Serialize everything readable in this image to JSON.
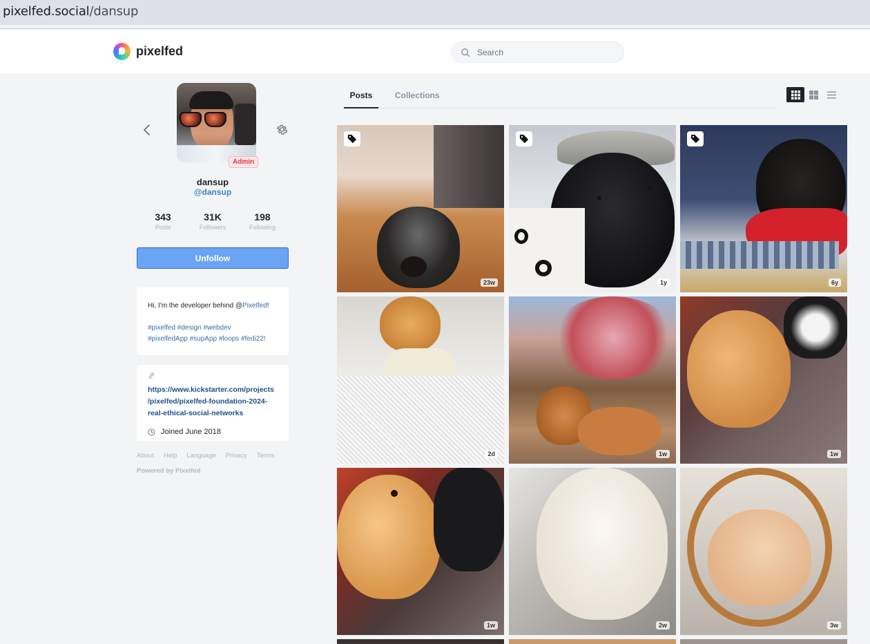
{
  "browser": {
    "domain": "pixelfed.social",
    "path": "/dansup"
  },
  "nav": {
    "brand": "pixelfed",
    "search_placeholder": "Search"
  },
  "profile": {
    "display_name": "dansup",
    "username": "@dansup",
    "badge": "Admin",
    "stats": [
      {
        "value": "343",
        "label": "Posts"
      },
      {
        "value": "31K",
        "label": "Followers"
      },
      {
        "value": "198",
        "label": "Following"
      }
    ],
    "follow_label": "Unfollow",
    "bio": {
      "intro": "Hi, I'm the developer behind @",
      "mention": "Pixelfed",
      "intro_end": "!",
      "tags_line1": "#pixelfed #design #webdev",
      "tags_line2": "#pixelfedApp #supApp #loops #fedi22!"
    },
    "website": "https://www.kickstarter.com/projects/pixelfed/pixelfed-foundation-2024-real-ethical-social-networks",
    "website_lines": [
      "https://www.kickstarter.com/projects",
      "/pixelfed/pixelfed-foundation-2024-",
      "real-ethical-social-networks"
    ],
    "joined": "Joined June 2018"
  },
  "footer": {
    "links": [
      "About",
      "Help",
      "Language",
      "Privacy",
      "Terms"
    ],
    "powered": "Powered by Pixelfed"
  },
  "tabs": [
    {
      "label": "Posts",
      "active": true
    },
    {
      "label": "Collections",
      "active": false
    }
  ],
  "view_modes": [
    "grid-3",
    "grid-2",
    "list"
  ],
  "posts": [
    {
      "time": "23w",
      "tagged": true
    },
    {
      "time": "1y",
      "tagged": true
    },
    {
      "time": "6y",
      "tagged": true
    },
    {
      "time": "2d",
      "tagged": false
    },
    {
      "time": "1w",
      "tagged": false
    },
    {
      "time": "1w",
      "tagged": false
    },
    {
      "time": "1w",
      "tagged": false
    },
    {
      "time": "2w",
      "tagged": false
    },
    {
      "time": "3w",
      "tagged": false
    }
  ],
  "colors": {
    "accent": "#6aa4f2",
    "admin": "#dc3545",
    "link": "#3b82c4"
  }
}
